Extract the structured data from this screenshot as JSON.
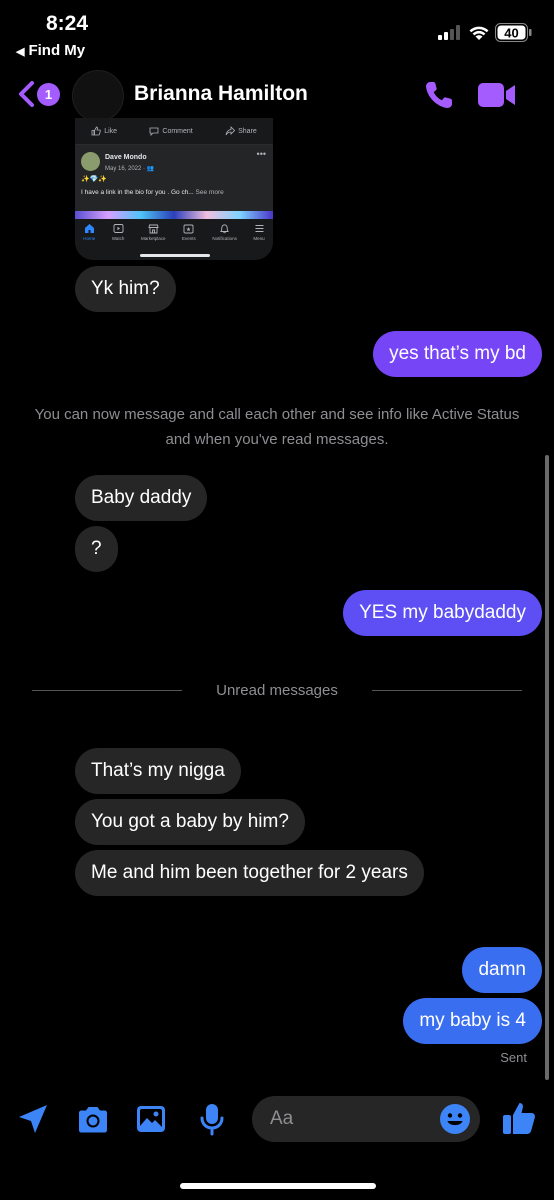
{
  "status_bar": {
    "time": "8:24",
    "back_app": "Find My",
    "battery": "40"
  },
  "header": {
    "unread_count": "1",
    "contact_name": "Brianna Hamilton",
    "accent_color": "#a55cff"
  },
  "shared_post": {
    "actions": [
      "Like",
      "Comment",
      "Share"
    ],
    "author": "Dave Mondo",
    "date": "May 16, 2022 · ",
    "emojis": "✨💎✨",
    "text": "I have a link in the bio for you . Go ch...",
    "see_more": "See more",
    "nav": [
      "Home",
      "Watch",
      "Marketplace",
      "Events",
      "Notifications",
      "Menu"
    ]
  },
  "messages": [
    {
      "dir": "in",
      "text": "Yk him?"
    },
    {
      "dir": "out",
      "text": "yes that’s my bd"
    },
    {
      "dir": "in",
      "text": "Baby daddy"
    },
    {
      "dir": "in",
      "text": "?"
    },
    {
      "dir": "out",
      "text": "YES my babydaddy"
    },
    {
      "dir": "in",
      "text": "That’s my nigga"
    },
    {
      "dir": "in",
      "text": "You got a baby by him?"
    },
    {
      "dir": "in",
      "text": "Me and him been together for 2 years"
    },
    {
      "dir": "out",
      "text": "damn"
    },
    {
      "dir": "out",
      "text": "my baby is 4"
    }
  ],
  "notice": "You can now message and call each other and see info like Active Status and when you've read messages.",
  "unread_divider": "Unread messages",
  "sent_status": "Sent",
  "composer": {
    "placeholder": "Aa"
  },
  "colors": {
    "outgoing_purple": "#7645f5",
    "outgoing_blue": "#3a6ef0",
    "icon_blue": "#3d84f7",
    "incoming": "#262626"
  }
}
